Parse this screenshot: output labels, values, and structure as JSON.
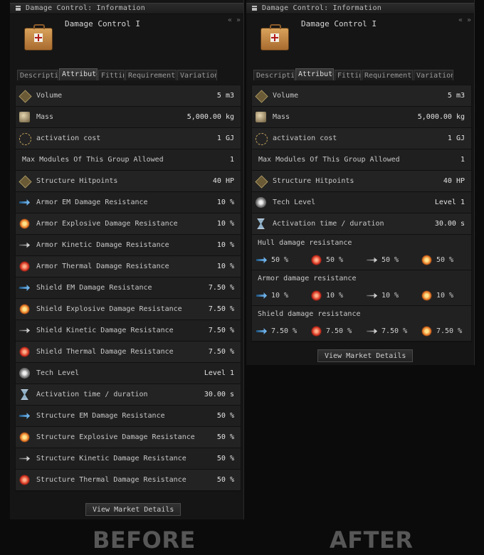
{
  "before": {
    "window_title": "Damage Control: Information",
    "item_name": "Damage Control I",
    "tabs": [
      {
        "label": "Description",
        "active": false
      },
      {
        "label": "Attributes",
        "active": true
      },
      {
        "label": "Fitting",
        "active": false
      },
      {
        "label": "Requirements",
        "active": false
      },
      {
        "label": "Variations",
        "active": false
      }
    ],
    "attributes": [
      {
        "icon": "volume",
        "label": "Volume",
        "value": "5 m3"
      },
      {
        "icon": "mass",
        "label": "Mass",
        "value": "5,000.00 kg"
      },
      {
        "icon": "capacitor",
        "label": "activation cost",
        "value": "1 GJ"
      },
      {
        "icon": "",
        "label": "Max Modules Of This Group Allowed",
        "value": "1"
      },
      {
        "icon": "structure",
        "label": "Structure Hitpoints",
        "value": "40 HP"
      },
      {
        "icon": "em",
        "label": "Armor EM Damage Resistance",
        "value": "10 %"
      },
      {
        "icon": "explosive",
        "label": "Armor Explosive Damage Resistance",
        "value": "10 %"
      },
      {
        "icon": "kinetic",
        "label": "Armor Kinetic Damage Resistance",
        "value": "10 %"
      },
      {
        "icon": "thermal",
        "label": "Armor Thermal Damage Resistance",
        "value": "10 %"
      },
      {
        "icon": "em",
        "label": "Shield EM Damage Resistance",
        "value": "7.50 %"
      },
      {
        "icon": "explosive",
        "label": "Shield Explosive Damage Resistance",
        "value": "7.50 %"
      },
      {
        "icon": "kinetic",
        "label": "Shield Kinetic Damage Resistance",
        "value": "7.50 %"
      },
      {
        "icon": "thermal",
        "label": "Shield Thermal Damage Resistance",
        "value": "7.50 %"
      },
      {
        "icon": "tech",
        "label": "Tech Level",
        "value": "Level 1"
      },
      {
        "icon": "hourglass",
        "label": "Activation time / duration",
        "value": "30.00 s"
      },
      {
        "icon": "em",
        "label": "Structure EM Damage Resistance",
        "value": "50 %"
      },
      {
        "icon": "explosive",
        "label": "Structure Explosive Damage Resistance",
        "value": "50 %"
      },
      {
        "icon": "kinetic",
        "label": "Structure Kinetic Damage Resistance",
        "value": "50 %"
      },
      {
        "icon": "thermal",
        "label": "Structure Thermal Damage Resistance",
        "value": "50 %"
      }
    ],
    "market_button": "View Market Details",
    "caption": "BEFORE"
  },
  "after": {
    "window_title": "Damage Control: Information",
    "item_name": "Damage Control I",
    "tabs": [
      {
        "label": "Description",
        "active": false
      },
      {
        "label": "Attributes",
        "active": true
      },
      {
        "label": "Fitting",
        "active": false
      },
      {
        "label": "Requirements",
        "active": false
      },
      {
        "label": "Variations",
        "active": false
      }
    ],
    "attributes": [
      {
        "icon": "volume",
        "label": "Volume",
        "value": "5 m3"
      },
      {
        "icon": "mass",
        "label": "Mass",
        "value": "5,000.00 kg"
      },
      {
        "icon": "capacitor",
        "label": "activation cost",
        "value": "1 GJ"
      },
      {
        "icon": "",
        "label": "Max Modules Of This Group Allowed",
        "value": "1"
      },
      {
        "icon": "structure",
        "label": "Structure Hitpoints",
        "value": "40 HP"
      },
      {
        "icon": "tech",
        "label": "Tech Level",
        "value": "Level 1"
      },
      {
        "icon": "hourglass",
        "label": "Activation time / duration",
        "value": "30.00 s"
      }
    ],
    "resistance_groups": [
      {
        "title": "Hull damage resistance",
        "values": [
          {
            "icon": "em",
            "value": "50 %"
          },
          {
            "icon": "thermal",
            "value": "50 %"
          },
          {
            "icon": "kinetic",
            "value": "50 %"
          },
          {
            "icon": "explosive",
            "value": "50 %"
          }
        ]
      },
      {
        "title": "Armor damage resistance",
        "values": [
          {
            "icon": "em",
            "value": "10 %"
          },
          {
            "icon": "thermal",
            "value": "10 %"
          },
          {
            "icon": "kinetic",
            "value": "10 %"
          },
          {
            "icon": "explosive",
            "value": "10 %"
          }
        ]
      },
      {
        "title": "Shield damage resistance",
        "values": [
          {
            "icon": "em",
            "value": "7.50 %"
          },
          {
            "icon": "thermal",
            "value": "7.50 %"
          },
          {
            "icon": "kinetic",
            "value": "7.50 %"
          },
          {
            "icon": "explosive",
            "value": "7.50 %"
          }
        ]
      }
    ],
    "market_button": "View Market Details",
    "caption": "AFTER"
  }
}
